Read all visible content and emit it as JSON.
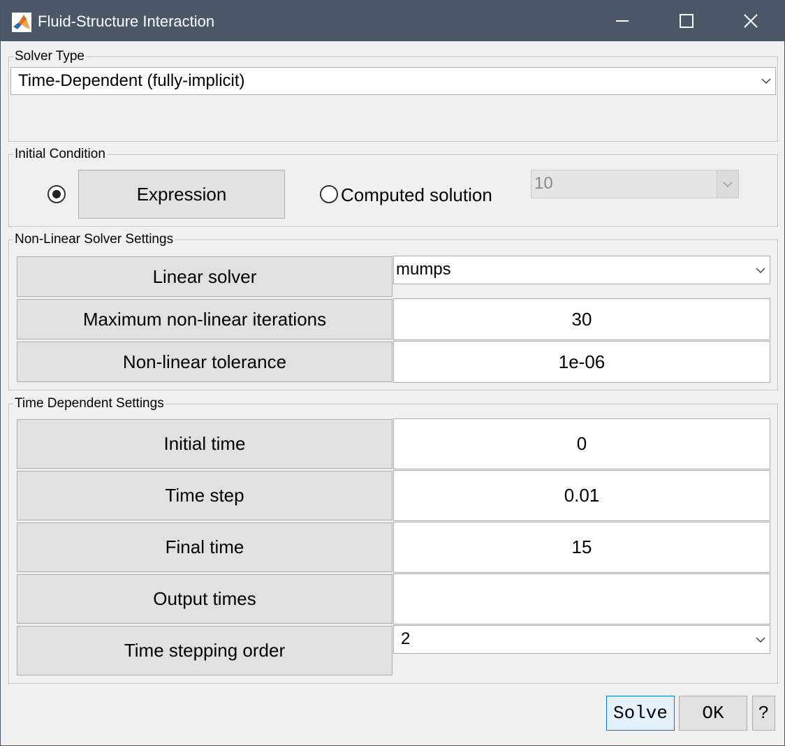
{
  "window": {
    "title": "Fluid-Structure Interaction",
    "icon": "matlab-icon",
    "controls": {
      "minimize": "minimize-icon",
      "maximize": "maximize-icon",
      "close": "close-icon"
    }
  },
  "solver_type": {
    "legend": "Solver Type",
    "selected": "Time-Dependent (fully-implicit)"
  },
  "initial_condition": {
    "legend": "Initial Condition",
    "expression_label": "Expression",
    "expression_selected": true,
    "computed_label": "Computed solution",
    "computed_value": "10"
  },
  "nonlinear": {
    "legend": "Non-Linear Solver Settings",
    "rows": [
      {
        "label": "Linear solver",
        "value": "mumps",
        "type": "dropdown"
      },
      {
        "label": "Maximum non-linear iterations",
        "value": "30",
        "type": "input"
      },
      {
        "label": "Non-linear tolerance",
        "value": "1e-06",
        "type": "input"
      }
    ]
  },
  "time_dependent": {
    "legend": "Time Dependent Settings",
    "rows": [
      {
        "label": "Initial time",
        "value": "0",
        "type": "input"
      },
      {
        "label": "Time step",
        "value": "0.01",
        "type": "input"
      },
      {
        "label": "Final time",
        "value": "15",
        "type": "input"
      },
      {
        "label": "Output times",
        "value": "",
        "type": "input"
      },
      {
        "label": "Time stepping order",
        "value": "2",
        "type": "dropdown"
      }
    ]
  },
  "footer": {
    "solve": "Solve",
    "ok": "OK",
    "help": "?"
  },
  "colors": {
    "titlebar": "#4c5867",
    "focus_border": "#0078d7"
  }
}
